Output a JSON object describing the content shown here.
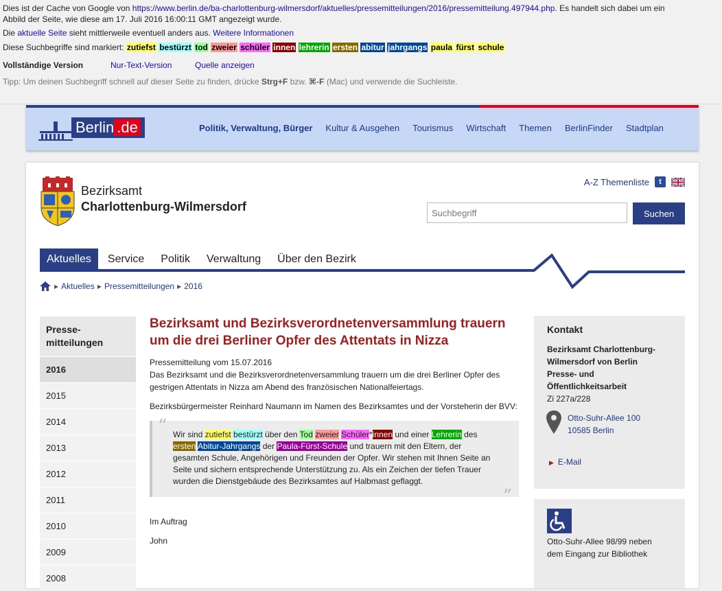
{
  "cache": {
    "line1_pre": "Dies ist der Cache von Google von ",
    "url": "https://www.berlin.de/ba-charlottenburg-wilmersdorf/aktuelles/pressemitteilungen/2016/pressemitteilung.497944.php",
    "line1_post": ". Es handelt sich dabei um ein",
    "line2": "Abbild der Seite, wie diese am 17. Juli 2016 16:00:11 GMT angezeigt wurde.",
    "line3_pre": "Die ",
    "current_page_link": "aktuelle Seite",
    "line3_mid": " sieht mittlerweile eventuell anders aus. ",
    "more_info_link": "Weitere Informationen",
    "terms_label": "Diese Suchbegriffe sind markiert: ",
    "terms": [
      {
        "text": "zutiefst",
        "bg": "#ffff66",
        "fg": "#000000"
      },
      {
        "text": "bestürzt",
        "bg": "#a0ffff",
        "fg": "#000000"
      },
      {
        "text": "tod",
        "bg": "#99ff99",
        "fg": "#000000"
      },
      {
        "text": "zweier",
        "bg": "#ff9999",
        "fg": "#000000"
      },
      {
        "text": "schüler",
        "bg": "#ff66ff",
        "fg": "#000000"
      },
      {
        "text": "innen",
        "bg": "#880000",
        "fg": "#ffffff"
      },
      {
        "text": "lehrerin",
        "bg": "#00aa00",
        "fg": "#ffffff"
      },
      {
        "text": "ersten",
        "bg": "#886800",
        "fg": "#ffffff"
      },
      {
        "text": "abitur",
        "bg": "#004699",
        "fg": "#ffffff"
      },
      {
        "text": "jahrgangs",
        "bg": "#004699",
        "fg": "#ffffff"
      },
      {
        "text": "paula",
        "bg": "#ffff66",
        "fg": "#000000"
      },
      {
        "text": "fürst",
        "bg": "#ffff66",
        "fg": "#000000"
      },
      {
        "text": "schule",
        "bg": "#ffff66",
        "fg": "#000000"
      }
    ],
    "full_version": "Vollständige Version",
    "text_version": "Nur-Text-Version",
    "source_link": "Quelle anzeigen",
    "tip_pre": "Tipp: Um deinen Suchbegriff schnell auf dieser Seite zu finden, drücke ",
    "tip_key1": "Strg+F",
    "tip_mid": " bzw. ",
    "tip_key2": "⌘-F",
    "tip_post": " (Mac) und verwende die Suchleiste."
  },
  "berlin_nav": {
    "logo": "Berlin",
    "logo_suffix": ".de",
    "items": [
      "Politik, Verwaltung, Bürger",
      "Kultur & Ausgehen",
      "Tourismus",
      "Wirtschaft",
      "Themen",
      "BerlinFinder",
      "Stadtplan"
    ]
  },
  "district": {
    "line1": "Bezirksamt",
    "line2": "Charlottenburg-Wilmersdorf"
  },
  "top_links": {
    "az": "A-Z Themenliste",
    "twitter_glyph": "t"
  },
  "search": {
    "placeholder": "Suchbegriff",
    "button": "Suchen"
  },
  "tabs": [
    "Aktuelles",
    "Service",
    "Politik",
    "Verwaltung",
    "Über den Bezirk"
  ],
  "breadcrumb": [
    "Aktuelles",
    "Pressemitteilungen",
    "2016"
  ],
  "sidebar": {
    "heading_line1": "Presse-",
    "heading_line2": "mitteilungen",
    "years": [
      "2016",
      "2015",
      "2014",
      "2013",
      "2012",
      "2011",
      "2010",
      "2009",
      "2008"
    ]
  },
  "article": {
    "title": "Bezirksamt und Bezirksverordnetenversammlung trauern um die drei Berliner Opfer des Attentats in Nizza",
    "date_line": "Pressemitteilung vom 15.07.2016",
    "intro": "Das Bezirksamt und die Bezirksverordnetenversammlung trauern um die drei Berliner Opfer des gestrigen Attentats in Nizza am Abend des französischen Nationalfeiertags.",
    "para2": "Bezirksbürgermeister Reinhard Naumann im Namen des Bezirksamtes und der Vorsteherin der BVV:",
    "quote": {
      "t1": "Wir sind ",
      "h1": "zutiefst",
      "s1": " ",
      "h2": "bestürzt",
      "t2": " über den ",
      "h3": "Tod",
      "s2": " ",
      "h4": "zweier",
      "s3": " ",
      "h5": "Schüler",
      "t3": "*",
      "h6": "innen",
      "t4": " und einer ",
      "h7": "Lehrerin",
      "t5": " des ",
      "h8": "ersten",
      "s4": " ",
      "h9": "Abitur-Jahrgangs",
      "t6": " der ",
      "h10": "Paula-Fürst-Schule",
      "t7": " und trauern mit den Eltern, der gesamten Schule, Angehörigen und Freunden der Opfer. Wir stehen mit Ihnen Seite an Seite und sichern entsprechende Unterstützung zu. Als ein Zeichen der tiefen Trauer wurden die Dienstgebäude des Bezirksamtes auf Halbmast geflaggt."
    },
    "signoff1": "Im Auftrag",
    "signoff2": "John"
  },
  "contact": {
    "heading": "Kontakt",
    "org_line1": "Bezirksamt Charlottenburg-",
    "org_line2": "Wilmersdorf von Berlin",
    "org_line3": "Presse- und",
    "org_line4": "Öffentlichkeitsarbeit",
    "room": "Zi 227a/228",
    "street": "Otto-Suhr-Allee 100",
    "city": "10585 Berlin",
    "email": "E-Mail"
  },
  "access": {
    "line1": "Otto-Suhr-Allee 98/99 neben",
    "line2": "dem Eingang zur Bibliothek"
  },
  "colors": {
    "berlin_blue": "#2b3f86",
    "berlin_red": "#e2001a",
    "title_red": "#a01e1e",
    "link_blue": "#1c3a88"
  },
  "icons": [
    "berlin-logo-icon",
    "coat-of-arms-icon",
    "twitter-icon",
    "uk-flag-icon",
    "home-icon",
    "map-pin-icon",
    "wheelchair-icon",
    "quote-icon"
  ]
}
